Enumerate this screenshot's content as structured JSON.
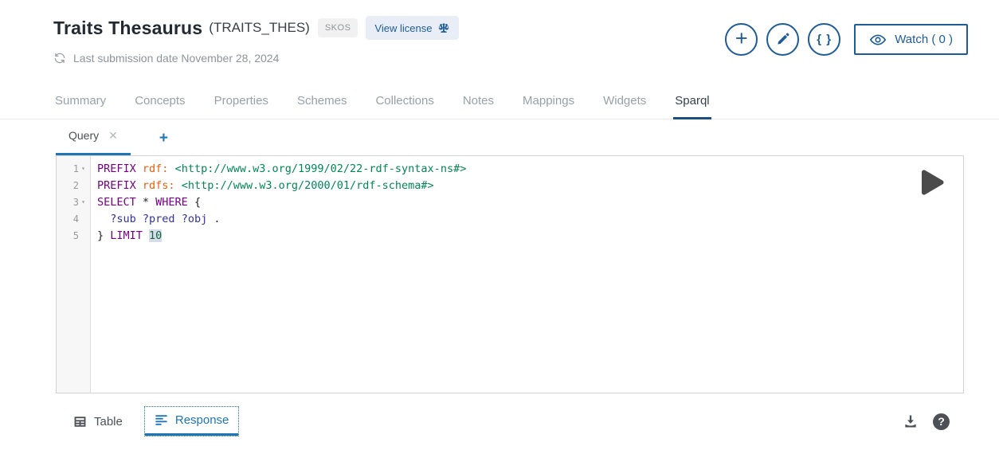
{
  "header": {
    "title": "Traits Thesaurus",
    "code": "(TRAITS_THES)",
    "badge": "SKOS",
    "view_license_label": "View license",
    "last_submission": "Last submission date November 28, 2024",
    "watch_label": "Watch ( 0 )"
  },
  "icons": {
    "plus": "+",
    "braces": "{ }",
    "close": "✕",
    "fold": "▾",
    "add_tab": "+",
    "help": "?"
  },
  "colors": {
    "accent": "#1d5c96",
    "link": "#2076b5",
    "sparql_underline": "#1d4e7e",
    "keyword": "#770088",
    "prefix": "#e8610a",
    "iri": "#008855",
    "variable": "#32329f",
    "number": "#116644",
    "number_highlight_bg": "#d7dde8"
  },
  "nav": {
    "tabs": [
      {
        "label": "Summary",
        "active": false
      },
      {
        "label": "Concepts",
        "active": false
      },
      {
        "label": "Properties",
        "active": false
      },
      {
        "label": "Schemes",
        "active": false
      },
      {
        "label": "Collections",
        "active": false
      },
      {
        "label": "Notes",
        "active": false
      },
      {
        "label": "Mappings",
        "active": false
      },
      {
        "label": "Widgets",
        "active": false
      },
      {
        "label": "Sparql",
        "active": true
      }
    ]
  },
  "query_tabs": {
    "tabs": [
      {
        "label": "Query"
      }
    ]
  },
  "editor": {
    "lines": [
      {
        "num": "1",
        "fold": true,
        "segments": [
          {
            "text": "PREFIX",
            "style": "kw"
          },
          {
            "text": " ",
            "style": "plain"
          },
          {
            "text": "rdf:",
            "style": "pfx"
          },
          {
            "text": " ",
            "style": "plain"
          },
          {
            "text": "<http://www.w3.org/1999/02/22-rdf-syntax-ns#>",
            "style": "iri"
          }
        ]
      },
      {
        "num": "2",
        "fold": false,
        "segments": [
          {
            "text": "PREFIX",
            "style": "kw"
          },
          {
            "text": " ",
            "style": "plain"
          },
          {
            "text": "rdfs:",
            "style": "pfx"
          },
          {
            "text": " ",
            "style": "plain"
          },
          {
            "text": "<http://www.w3.org/2000/01/rdf-schema#>",
            "style": "iri"
          }
        ]
      },
      {
        "num": "3",
        "fold": true,
        "segments": [
          {
            "text": "SELECT",
            "style": "kw"
          },
          {
            "text": " * ",
            "style": "plain"
          },
          {
            "text": "WHERE",
            "style": "kw"
          },
          {
            "text": " {",
            "style": "plain"
          }
        ]
      },
      {
        "num": "4",
        "fold": false,
        "segments": [
          {
            "text": "  ",
            "style": "plain"
          },
          {
            "text": "?sub",
            "style": "var"
          },
          {
            "text": " ",
            "style": "plain"
          },
          {
            "text": "?pred",
            "style": "var"
          },
          {
            "text": " ",
            "style": "plain"
          },
          {
            "text": "?obj",
            "style": "var"
          },
          {
            "text": " .",
            "style": "plain"
          }
        ]
      },
      {
        "num": "5",
        "fold": false,
        "segments": [
          {
            "text": "} ",
            "style": "plain"
          },
          {
            "text": "LIMIT",
            "style": "kw"
          },
          {
            "text": " ",
            "style": "plain"
          },
          {
            "text": "10",
            "style": "num",
            "highlight": true
          }
        ]
      }
    ]
  },
  "results": {
    "tabs": [
      {
        "label": "Table",
        "active": false
      },
      {
        "label": "Response",
        "active": true
      }
    ]
  }
}
